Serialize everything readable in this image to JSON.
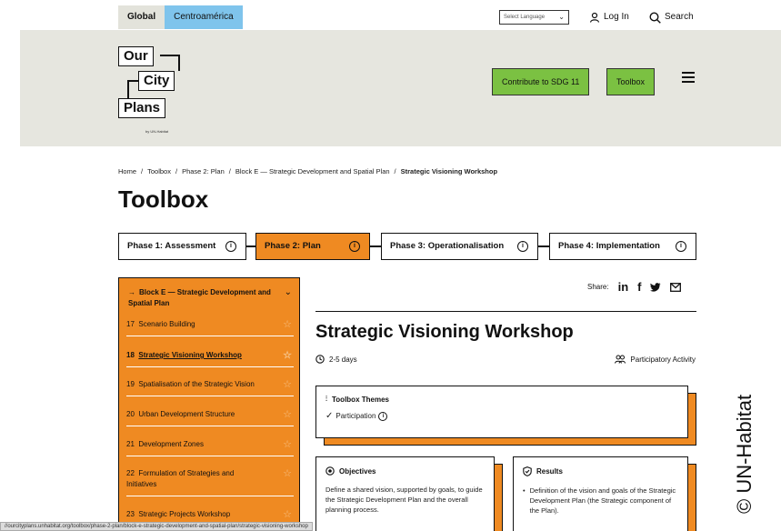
{
  "topbar": {
    "region_tabs": [
      "Global",
      "Centroamérica"
    ],
    "language_placeholder": "Select Language",
    "login": "Log In",
    "search": "Search"
  },
  "header": {
    "logo": {
      "words": [
        "Our",
        "City",
        "Plans"
      ],
      "by": "by UN-Habitat"
    },
    "contribute_button": "Contribute to SDG 11",
    "toolbox_button": "Toolbox"
  },
  "breadcrumb": [
    "Home",
    "Toolbox",
    "Phase 2: Plan",
    "Block E — Strategic Development and Spatial Plan",
    "Strategic Visioning Workshop"
  ],
  "page_title": "Toolbox",
  "phases": [
    {
      "label": "Phase 1: Assessment",
      "active": false
    },
    {
      "label": "Phase 2: Plan",
      "active": true
    },
    {
      "label": "Phase 3: Operationalisation",
      "active": false
    },
    {
      "label": "Phase 4: Implementation",
      "active": false
    }
  ],
  "sidebar": {
    "heading": "Block E — Strategic Development and Spatial Plan",
    "items": [
      {
        "num": "17",
        "label": "Scenario Building"
      },
      {
        "num": "18",
        "label": "Strategic Visioning Workshop"
      },
      {
        "num": "19",
        "label": "Spatialisation of the Strategic Vision"
      },
      {
        "num": "20",
        "label": "Urban Development Structure"
      },
      {
        "num": "21",
        "label": "Development Zones"
      },
      {
        "num": "22",
        "label": "Formulation of Strategies and Initiatives"
      },
      {
        "num": "23",
        "label": "Strategic Projects Workshop"
      }
    ]
  },
  "content": {
    "share_label": "Share:",
    "title": "Strategic Visioning Workshop",
    "duration": "2-5 days",
    "activity_type": "Participatory Activity",
    "themes": {
      "title": "Toolbox Themes",
      "item": "Participation"
    },
    "objectives": {
      "title": "Objectives",
      "text": "Define a shared vision, supported by goals, to guide the Strategic Development Plan and the overall planning process."
    },
    "results": {
      "title": "Results",
      "text": "Definition of the vision and goals of the Strategic Development Plan (the Strategic component of the Plan)."
    }
  },
  "status_url": "//ourcityplans.unhabitat.org/toolbox/phase-2-plan/block-e-strategic-development-and-spatial-plan/strategic-visioning-workshop",
  "watermark": "© UN-Habitat",
  "colors": {
    "orange": "#ef8a22",
    "green": "#7bc142",
    "header_bg": "#e6e6df",
    "blue_tab": "#7fc4ec"
  }
}
